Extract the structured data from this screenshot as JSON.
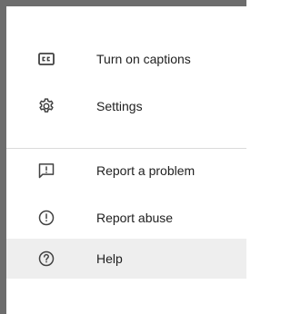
{
  "menu": {
    "items": [
      {
        "label": "Turn on captions",
        "icon": "closed-captions-icon"
      },
      {
        "label": "Settings",
        "icon": "gear-icon"
      },
      {
        "label": "Report a problem",
        "icon": "feedback-icon"
      },
      {
        "label": "Report abuse",
        "icon": "error-outline-icon"
      },
      {
        "label": "Help",
        "icon": "help-outline-icon"
      }
    ],
    "highlighted_item": "Help"
  }
}
